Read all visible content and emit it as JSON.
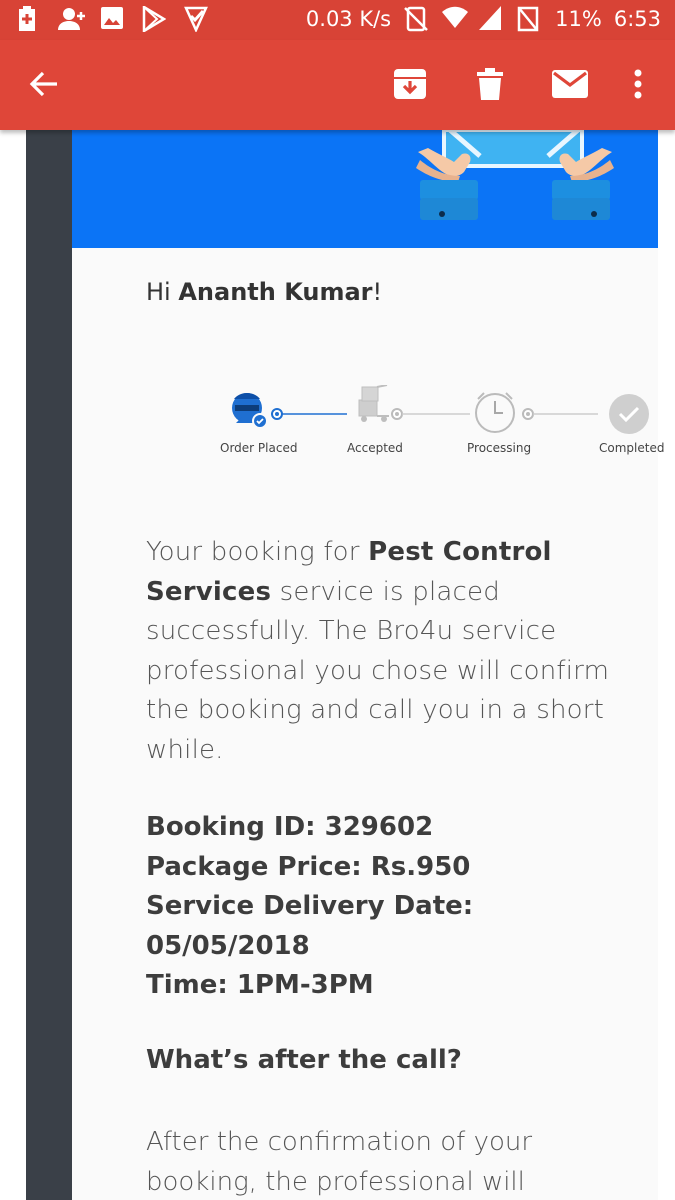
{
  "status_bar": {
    "network_speed": "0.03 K/s",
    "battery": "11%",
    "time": "6:53"
  },
  "app_bar": {
    "icons": [
      "back-arrow-icon",
      "archive-icon",
      "delete-icon",
      "mark-unread-icon",
      "more-icon"
    ]
  },
  "email": {
    "greeting_prefix": "Hi ",
    "greeting_name": "Ananth Kumar",
    "greeting_suffix": "!",
    "steps": [
      {
        "label": "Order Placed"
      },
      {
        "label": "Accepted"
      },
      {
        "label": "Processing"
      },
      {
        "label": "Completed"
      }
    ],
    "body": {
      "p1": "Your booking for ",
      "service": "Pest Control Services",
      "p2": " service is placed successfully. The Bro4u service professional you chose will confirm the booking and call you in a short while."
    },
    "details": {
      "booking_id": "Booking ID: 329602",
      "package_price": "Package Price: Rs.950",
      "delivery_date_label": "Service Delivery Date:",
      "delivery_date": "05/05/2018",
      "time": "Time: 1PM-3PM"
    },
    "after_heading": "What’s after the call?",
    "after_text": "After the confirmation of your booking, the professional will"
  },
  "colors": {
    "status_bar": "#d84336",
    "app_bar": "#df4639",
    "banner": "#0b74f6",
    "frame": "#3a4048"
  }
}
